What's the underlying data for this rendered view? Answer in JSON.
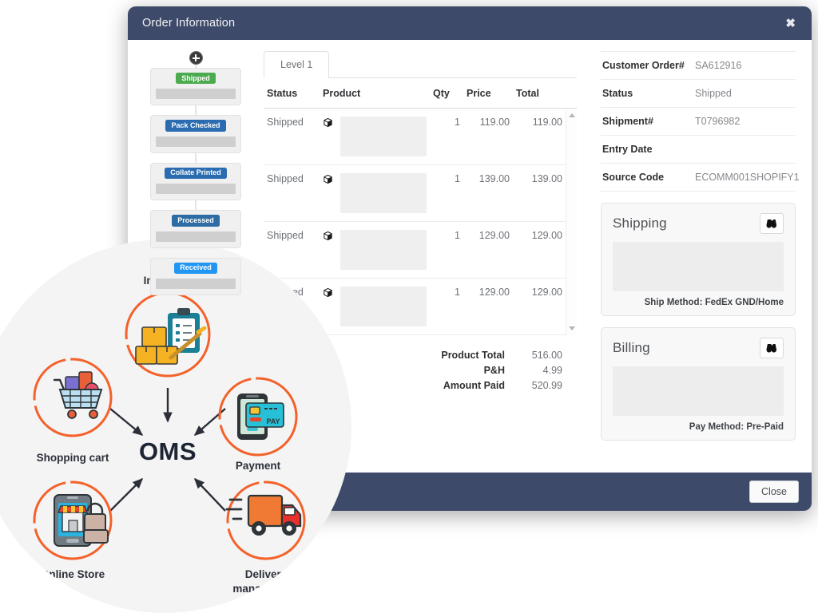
{
  "modal": {
    "title": "Order Information",
    "close_x_icon": "close-icon",
    "close_button_label": "Close"
  },
  "timeline": {
    "add_icon": "plus-circle-icon",
    "steps": [
      {
        "badge": "Shipped",
        "color": "#4cab4f"
      },
      {
        "badge": "Pack Checked",
        "color": "#2b6cb0"
      },
      {
        "badge": "Collate Printed",
        "color": "#2b6cb0"
      },
      {
        "badge": "Processed",
        "color": "#2e6da4"
      },
      {
        "badge": "Received",
        "color": "#2196f3"
      }
    ]
  },
  "items_panel": {
    "tab_label": "Level 1",
    "columns": [
      "Status",
      "Product",
      "Qty",
      "Price",
      "Total"
    ],
    "rows": [
      {
        "status": "Shipped",
        "product_icon": "package-icon",
        "qty": "1",
        "price": "119.00",
        "total": "119.00"
      },
      {
        "status": "Shipped",
        "product_icon": "package-icon",
        "qty": "1",
        "price": "139.00",
        "total": "139.00"
      },
      {
        "status": "Shipped",
        "product_icon": "package-icon",
        "qty": "1",
        "price": "129.00",
        "total": "129.00"
      },
      {
        "status": "Shipped",
        "product_icon": "package-icon",
        "qty": "1",
        "price": "129.00",
        "total": "129.00"
      }
    ],
    "totals": [
      {
        "label": "Product Total",
        "value": "516.00"
      },
      {
        "label": "P&H",
        "value": "4.99"
      },
      {
        "label": "Amount Paid",
        "value": "520.99"
      }
    ]
  },
  "order_details": [
    {
      "key": "Customer Order#",
      "value": "SA612916"
    },
    {
      "key": "Status",
      "value": "Shipped"
    },
    {
      "key": "Shipment#",
      "value": ""
    },
    {
      "key": "Entry Date",
      "value": ""
    },
    {
      "key": "Source Code",
      "value": "ECOMM001SHOPIFY1"
    }
  ],
  "shipment_number": "T0796982",
  "shipping_card": {
    "title": "Shipping",
    "view_icon": "binoculars-icon",
    "footer": "Ship Method: FedEx GND/Home"
  },
  "billing_card": {
    "title": "Billing",
    "view_icon": "binoculars-icon",
    "footer": "Pay Method: Pre-Paid"
  },
  "oms_diagram": {
    "center_label": "OMS",
    "nodes": [
      {
        "label": "Inventory",
        "icon": "inventory-boxes-clipboard-icon"
      },
      {
        "label": "Payment",
        "icon": "mobile-payment-card-icon"
      },
      {
        "label": "Shopping cart",
        "icon": "shopping-cart-icon"
      },
      {
        "label": "Online Store",
        "icon": "mobile-storefront-icon"
      },
      {
        "label": "Delivery management",
        "icon": "delivery-truck-icon"
      }
    ],
    "accent_color": "#f4612a"
  }
}
